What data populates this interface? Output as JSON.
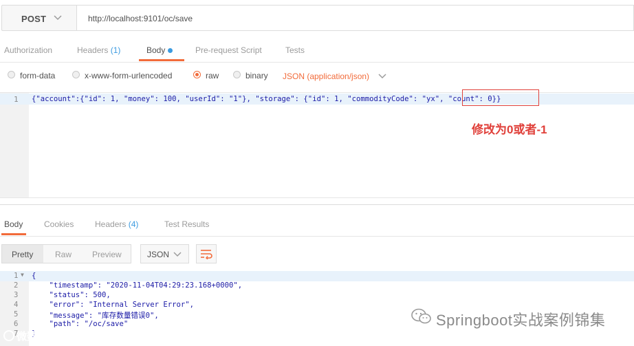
{
  "request": {
    "method": "POST",
    "url": "http://localhost:9101/oc/save",
    "tabs": [
      {
        "label": "Authorization"
      },
      {
        "label": "Headers",
        "count": "(1)"
      },
      {
        "label": "Body"
      },
      {
        "label": "Pre-request Script"
      },
      {
        "label": "Tests"
      }
    ],
    "body_types": [
      "form-data",
      "x-www-form-urlencoded",
      "raw",
      "binary"
    ],
    "selected_body_type": "raw",
    "content_type": "JSON (application/json)",
    "editor_line_number": "1",
    "editor_line": "{\"account\":{\"id\": 1, \"money\": 100, \"userId\": \"1\"}, \"storage\": {\"id\": 1, \"commodityCode\": \"yx\", \"count\": 0}}",
    "annotation": "修改为0或者-1"
  },
  "response": {
    "tabs": [
      {
        "label": "Body"
      },
      {
        "label": "Cookies"
      },
      {
        "label": "Headers",
        "count": "(4)"
      },
      {
        "label": "Test Results"
      }
    ],
    "view_modes": [
      "Pretty",
      "Raw",
      "Preview"
    ],
    "format": "JSON",
    "lines": [
      {
        "n": "1",
        "text": "{"
      },
      {
        "n": "2",
        "text": "    \"timestamp\": \"2020-11-04T04:29:23.168+0000\","
      },
      {
        "n": "3",
        "text": "    \"status\": 500,"
      },
      {
        "n": "4",
        "text": "    \"error\": \"Internal Server Error\","
      },
      {
        "n": "5",
        "text": "    \"message\": \"库存数量错误0\","
      },
      {
        "n": "6",
        "text": "    \"path\": \"/oc/save\""
      },
      {
        "n": "7",
        "text": "}"
      }
    ]
  },
  "watermarks": {
    "main": "Springboot实战案例锦集",
    "corner": "微数跨境"
  },
  "colors": {
    "accent": "#f26b3a",
    "link_blue": "#3c9be0",
    "annotation_red": "#e0403a",
    "json_blue": "#1a1aa6"
  }
}
